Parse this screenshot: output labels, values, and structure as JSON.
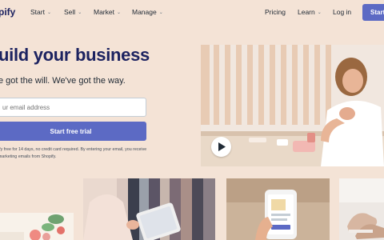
{
  "nav": {
    "logo": "pify",
    "left_items": [
      {
        "label": "Start",
        "has_dropdown": true
      },
      {
        "label": "Sell",
        "has_dropdown": true
      },
      {
        "label": "Market",
        "has_dropdown": true
      },
      {
        "label": "Manage",
        "has_dropdown": true
      }
    ],
    "pricing": "Pricing",
    "learn": "Learn",
    "login": "Log in",
    "cta": "Start"
  },
  "hero": {
    "title": "uild your business",
    "subtitle": "e got the will. We've got the way.",
    "email_placeholder": "ur email address",
    "cta": "Start free trial",
    "fine_print": "ify free for 14 days, no credit card required. By entering your email, you receive marketing emails from Shopify."
  },
  "colors": {
    "background": "#f4e3d6",
    "brand_purple": "#5c6ac4",
    "heading_navy": "#1c2260"
  },
  "icons": {
    "play": "play-icon",
    "chevron": "chevron-down-icon"
  }
}
